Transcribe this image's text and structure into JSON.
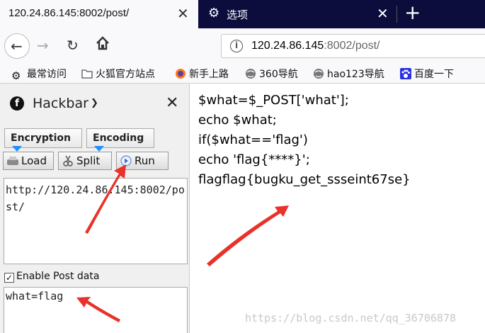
{
  "tabs": [
    {
      "title": "120.24.86.145:8002/post/",
      "active": true
    },
    {
      "title": "选项",
      "icon": "gear-icon",
      "active": false
    }
  ],
  "nav": {
    "url_host": "120.24.86.145",
    "url_rest": ":8002/post/"
  },
  "bookmarks": [
    {
      "label": "最常访问",
      "icon": "gear-icon"
    },
    {
      "label": "火狐官方站点",
      "icon": "folder-icon"
    },
    {
      "label": "新手上路",
      "icon": "firefox-icon"
    },
    {
      "label": "360导航",
      "icon": "globe-icon"
    },
    {
      "label": "hao123导航",
      "icon": "globe-icon"
    },
    {
      "label": "百度一下",
      "icon": "baidu-paw-icon"
    }
  ],
  "hackbar": {
    "title": "Hackbar",
    "encryption_label": "Encryption",
    "encoding_label": "Encoding",
    "load_label": "Load",
    "split_label": "Split",
    "run_label": "Run",
    "url_value": "http://120.24.86.145:8002/post/",
    "enable_post_label": "Enable Post data",
    "post_value": "what=flag"
  },
  "page": {
    "lines": [
      "$what=$_POST['what'];",
      "echo $what;",
      "if($what=='flag')",
      "echo 'flag{****}';",
      "flagflag{bugku_get_ssseint67se}"
    ]
  },
  "watermark": "https://blog.csdn.net/qq_36706878",
  "colors": {
    "tabstrip": "#0c0c3d",
    "arrow": "#e8322a",
    "accent": "#1e90ff"
  }
}
